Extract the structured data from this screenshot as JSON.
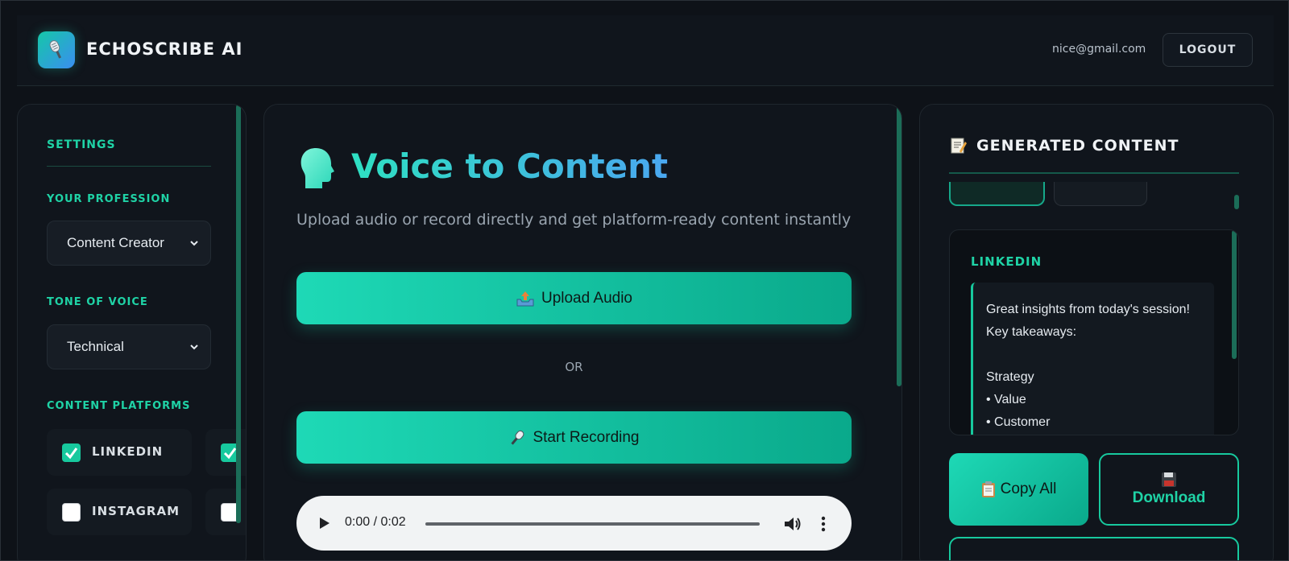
{
  "header": {
    "brand": "ECHOSCRIBE AI",
    "user_email": "nice@gmail.com",
    "logout_label": "LOGOUT",
    "logo_icon": "microphone-icon"
  },
  "settings": {
    "heading": "SETTINGS",
    "profession_label": "YOUR PROFESSION",
    "profession_value": "Content Creator",
    "tone_label": "TONE OF VOICE",
    "tone_value": "Technical",
    "platforms_label": "CONTENT PLATFORMS",
    "platforms": [
      {
        "label": "LINKEDIN",
        "checked": true
      },
      {
        "label": "",
        "checked": true
      },
      {
        "label": "INSTAGRAM",
        "checked": false
      },
      {
        "label": "",
        "checked": false
      }
    ]
  },
  "main": {
    "title": "Voice to Content",
    "title_icon": "head-silhouette-icon",
    "subtitle": "Upload audio or record directly and get platform-ready content instantly",
    "upload_label": "Upload Audio",
    "upload_icon": "outbox-tray-icon",
    "or_label": "OR",
    "record_label": "Start Recording",
    "record_icon": "microphone-icon",
    "player_time": "0:00 / 0:02"
  },
  "generated": {
    "heading": "GENERATED CONTENT",
    "heading_icon": "memo-icon",
    "card_title": "LINKEDIN",
    "card_lines": [
      "Great insights from today's session!",
      "Key takeaways:",
      "",
      "Strategy",
      "• Value",
      "• Customer"
    ],
    "copy_label": "Copy All",
    "copy_icon": "clipboard-icon",
    "download_label": "Download",
    "download_icon": "floppy-disk-icon"
  },
  "colors": {
    "accent": "#1fd3a6",
    "background": "#0e1218",
    "panel": "#10151c"
  }
}
